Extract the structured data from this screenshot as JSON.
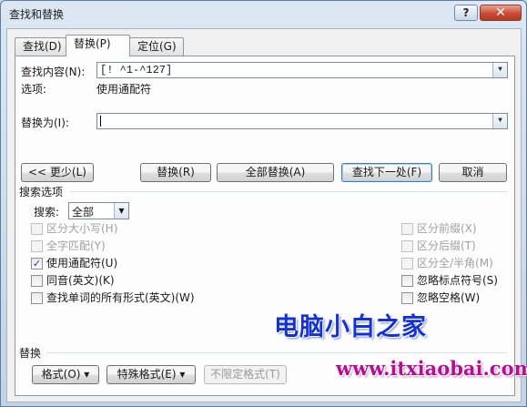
{
  "window": {
    "title": "查找和替换",
    "help_label": "?",
    "close_label": "✕"
  },
  "tabs": [
    {
      "label": "查找(D)",
      "active": false
    },
    {
      "label": "替换(P)",
      "active": true
    },
    {
      "label": "定位(G)",
      "active": false
    }
  ],
  "find": {
    "label": "查找内容(N):",
    "value": "[! ^1-^127]",
    "options_label": "选项:",
    "options_value": "使用通配符"
  },
  "replace": {
    "label": "替换为(I):",
    "value": ""
  },
  "buttons": {
    "less": "<< 更少(L)",
    "replace": "替换(R)",
    "replace_all": "全部替换(A)",
    "find_next": "查找下一处(F)",
    "cancel": "取消"
  },
  "search_options": {
    "title": "搜索选项",
    "search_label": "搜索:",
    "search_value": "全部",
    "left": [
      {
        "label": "区分大小写(H)",
        "checked": false,
        "disabled": true
      },
      {
        "label": "全字匹配(Y)",
        "checked": false,
        "disabled": true
      },
      {
        "label": "使用通配符(U)",
        "checked": true,
        "disabled": false
      },
      {
        "label": "同音(英文)(K)",
        "checked": false,
        "disabled": false
      },
      {
        "label": "查找单词的所有形式(英文)(W)",
        "checked": false,
        "disabled": false
      }
    ],
    "right": [
      {
        "label": "区分前缀(X)",
        "checked": false,
        "disabled": true
      },
      {
        "label": "区分后缀(T)",
        "checked": false,
        "disabled": true
      },
      {
        "label": "区分全/半角(M)",
        "checked": false,
        "disabled": true
      },
      {
        "label": "忽略标点符号(S)",
        "checked": false,
        "disabled": false
      },
      {
        "label": "忽略空格(W)",
        "checked": false,
        "disabled": false
      }
    ]
  },
  "replace_section": {
    "title": "替换",
    "format_label": "格式(O) ▾",
    "special_label": "特殊格式(E) ▾",
    "no_format_label": "不限定格式(T)"
  },
  "watermark": {
    "cn_text": "电脑小白之家",
    "url_text": "www.itxiaobai.com"
  },
  "colors": {
    "watermark_cn": "#1533c9",
    "watermark_url": "#b0128f",
    "title_bar": "#c3d3e6",
    "close_button": "#c94b32"
  }
}
